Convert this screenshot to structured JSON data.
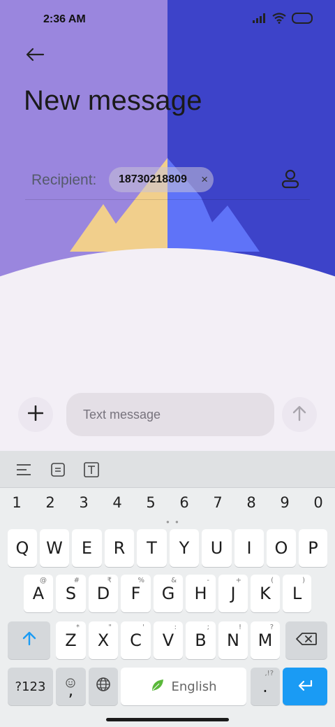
{
  "status_bar": {
    "time": "2:36 AM",
    "icons": [
      "signal-icon",
      "wifi-icon",
      "battery-icon"
    ]
  },
  "header": {
    "back_icon": "arrow-left-icon",
    "title": "New message"
  },
  "recipient": {
    "label": "Recipient:",
    "chip_value": "18730218809",
    "chip_remove": "×",
    "contact_icon": "person-icon"
  },
  "compose": {
    "add_icon": "plus-icon",
    "placeholder": "Text message",
    "value": "",
    "send_icon": "arrow-up-icon"
  },
  "keyboard": {
    "toolbar_icons": [
      "align-left-icon",
      "text-box-icon",
      "text-t-icon"
    ],
    "number_row": [
      "1",
      "2",
      "3",
      "4",
      "5",
      "6",
      "7",
      "8",
      "9",
      "0"
    ],
    "row1": [
      {
        "k": "Q",
        "h": ""
      },
      {
        "k": "W",
        "h": ""
      },
      {
        "k": "E",
        "h": ""
      },
      {
        "k": "R",
        "h": ""
      },
      {
        "k": "T",
        "h": ""
      },
      {
        "k": "Y",
        "h": ""
      },
      {
        "k": "U",
        "h": ""
      },
      {
        "k": "I",
        "h": ""
      },
      {
        "k": "O",
        "h": ""
      },
      {
        "k": "P",
        "h": ""
      }
    ],
    "row2": [
      {
        "k": "A",
        "h": "@"
      },
      {
        "k": "S",
        "h": "#"
      },
      {
        "k": "D",
        "h": "₹"
      },
      {
        "k": "F",
        "h": "%"
      },
      {
        "k": "G",
        "h": "&"
      },
      {
        "k": "H",
        "h": "-"
      },
      {
        "k": "J",
        "h": "+"
      },
      {
        "k": "K",
        "h": "("
      },
      {
        "k": "L",
        "h": ")"
      }
    ],
    "row3": [
      {
        "k": "Z",
        "h": "*"
      },
      {
        "k": "X",
        "h": "\""
      },
      {
        "k": "C",
        "h": "'"
      },
      {
        "k": "V",
        "h": ":"
      },
      {
        "k": "B",
        "h": ";"
      },
      {
        "k": "N",
        "h": "!"
      },
      {
        "k": "M",
        "h": "?"
      }
    ],
    "shift_icon": "shift-arrow-icon",
    "backspace_icon": "backspace-icon",
    "symbols_label": "?123",
    "comma_label": ",",
    "emoji_icon": "emoji-icon",
    "globe_icon": "globe-icon",
    "space_label": "English",
    "space_icon": "leaf-icon",
    "period_label": ".",
    "period_hint": ",!?",
    "enter_icon": "enter-arrow-icon"
  },
  "colors": {
    "bg_left": "#9a86de",
    "bg_right": "#3d43c9",
    "mountain_left": "#f1cf8c",
    "mountain_right": "#5f73f8",
    "enter_key": "#1a9bf4"
  }
}
